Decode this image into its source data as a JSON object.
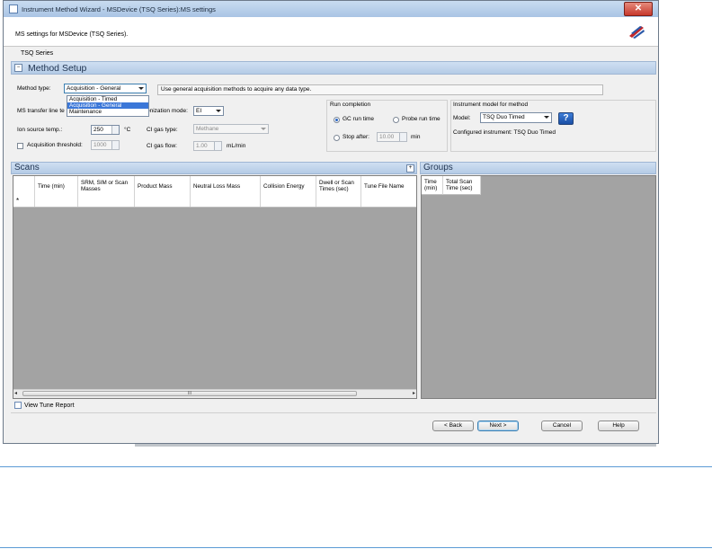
{
  "window": {
    "title": "Instrument Method Wizard - MSDevice (TSQ Series):MS settings",
    "close_glyph": "✕",
    "header_text": "MS settings for MSDevice (TSQ Series).",
    "tab_label": "TSQ Series"
  },
  "method_setup": {
    "title": "Method Setup",
    "method_type_label": "Method type:",
    "method_type_value": "Acquisition - General",
    "method_type_options": [
      "Acquisition - Timed",
      "Acquisition - General",
      "Maintenance"
    ],
    "description": "Use general acquisition methods to acquire any data type.",
    "ms_transfer_label": "MS transfer line te",
    "ionization_mode_label": "onization mode:",
    "ionization_mode_value": "EI",
    "ion_source_temp_label": "Ion source temp.:",
    "ion_source_temp_value": "250",
    "ion_source_temp_unit": "°C",
    "acq_threshold_label": "Acquisition threshold:",
    "acq_threshold_value": "1000",
    "ci_gas_type_label": "CI gas type:",
    "ci_gas_type_value": "Methane",
    "ci_gas_flow_label": "CI gas flow:",
    "ci_gas_flow_value": "1.00",
    "ci_gas_flow_unit": "mL/min",
    "run_completion": {
      "title": "Run completion",
      "gc_run_time": "GC run time",
      "probe_run_time": "Probe run time",
      "stop_after": "Stop after:",
      "stop_after_value": "10.00",
      "stop_after_unit": "min"
    },
    "instrument_model": {
      "title": "Instrument model for method",
      "model_label": "Model:",
      "model_value": "TSQ Duo Timed",
      "configured_text": "Configured instrument: TSQ Duo Timed"
    }
  },
  "scans": {
    "title": "Scans",
    "columns": [
      "Time (min)",
      "SRM, SIM or Scan Masses",
      "Product Mass",
      "Neutral Loss Mass",
      "Collision Energy",
      "Dwell or Scan Times (sec)",
      "Tune File Name"
    ],
    "new_row_marker": "*",
    "scroll_grip": "III",
    "scroll_left": "◂",
    "scroll_right": "▸"
  },
  "groups": {
    "title": "Groups",
    "columns": [
      "Time (min)",
      "Total Scan Time (sec)"
    ]
  },
  "footer": {
    "view_tune_report": "View Tune Report",
    "back": "< Back",
    "next": "Next >",
    "cancel": "Cancel",
    "help": "Help"
  },
  "icons": {
    "help": "?",
    "collapse": "−",
    "expand": "+"
  }
}
